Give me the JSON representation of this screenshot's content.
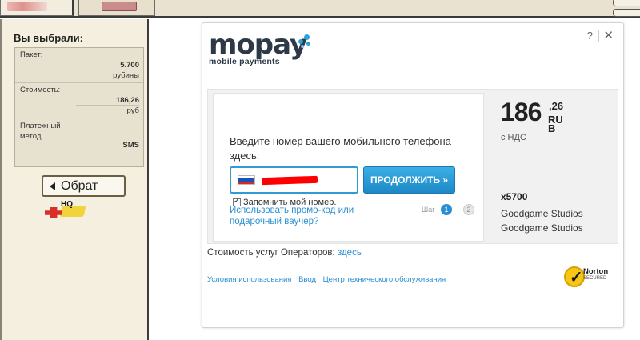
{
  "left_panel": {
    "title": "Вы выбрали:",
    "package_label": "Пакет:",
    "package_value": "5.700",
    "package_unit": "рубины",
    "cost_label": "Стоимость:",
    "cost_value": "186,26",
    "cost_unit": "руб",
    "method_label": "Платежный метод",
    "method_value": "SMS",
    "back_button": "Обрат",
    "hq_label": "HQ"
  },
  "modal": {
    "logo_text": "mopay",
    "logo_subtitle": "mobile payments",
    "help": "?",
    "close": "✕",
    "prompt": "Введите номер вашего мобильного телефона здесь:",
    "continue_button": "ПРОДОЛЖИТЬ »",
    "remember_label": "Запомнить мой номер.",
    "promo_link": "Использовать промо-код или подарочный ваучер?",
    "step_label": "Шаг",
    "step_1": "1",
    "step_2": "2",
    "price_main": "186",
    "price_decimals": ",26",
    "currency": "RUB",
    "vat": "с НДС",
    "quantity": "x5700",
    "merchant_line1": "Goodgame Studios",
    "merchant_line2": "Goodgame Studios",
    "operators_text": "Стоимость услуг Операторов:",
    "operators_link": "здесь",
    "footer": {
      "terms": "Условия использования",
      "login": "Ввод",
      "support": "Центр технического обслуживания"
    },
    "norton_brand": "Norton",
    "norton_secured": "SECURED"
  },
  "colors": {
    "accent": "#2a8fd2",
    "panel_bg": "#f4efde",
    "button_blue": "#1e88c6"
  }
}
